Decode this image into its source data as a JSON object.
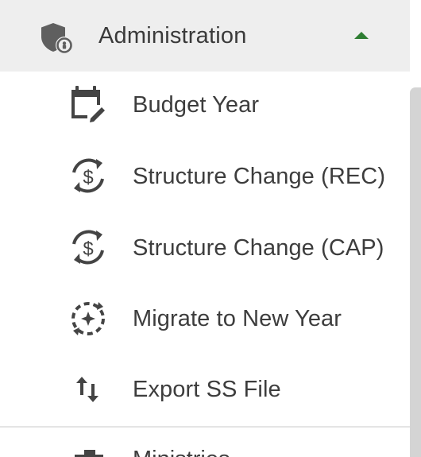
{
  "section": {
    "title": "Administration",
    "icon": "shield-lock-icon",
    "expanded": true,
    "chevron_color": "#2e7d32"
  },
  "items": [
    {
      "label": "Budget Year",
      "icon": "calendar-edit-icon"
    },
    {
      "label": "Structure Change (REC)",
      "icon": "currency-sync-icon"
    },
    {
      "label": "Structure Change (CAP)",
      "icon": "currency-sync-icon"
    },
    {
      "label": "Migrate to New Year",
      "icon": "dashed-sync-sparkle-icon"
    },
    {
      "label": "Export SS File",
      "icon": "swap-vertical-icon"
    }
  ],
  "next_item": {
    "label": "Ministries",
    "icon": "building-icon"
  },
  "colors": {
    "header_bg": "#eeeeee",
    "text": "#3d3d3d",
    "icon": "#444444",
    "scrollbar": "#d4d4d4"
  }
}
